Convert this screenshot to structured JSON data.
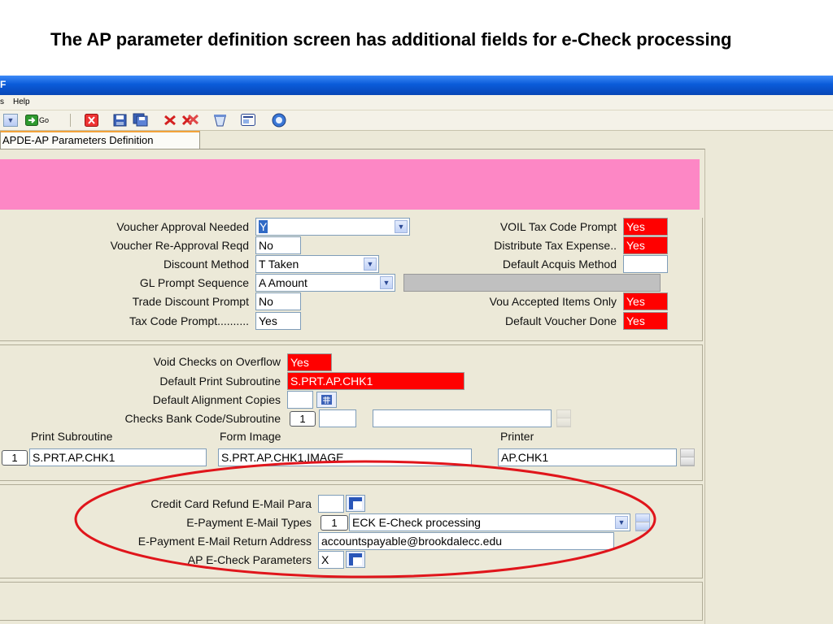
{
  "slide": {
    "title": "The AP parameter definition screen has additional fields for e-Check processing"
  },
  "window": {
    "title_fragment": "F",
    "menu": {
      "item_partial": "s",
      "help": "Help"
    },
    "toolbar": {
      "go_label": "Go"
    },
    "tab_label": "APDE-AP Parameters Definition"
  },
  "section1": {
    "voucher_approval_needed": {
      "label": "Voucher Approval Needed",
      "value": "Y"
    },
    "voucher_reapproval_reqd": {
      "label": "Voucher Re-Approval Reqd",
      "value": "No"
    },
    "discount_method": {
      "label": "Discount Method",
      "value": "T Taken"
    },
    "gl_prompt_sequence": {
      "label": "GL Prompt Sequence",
      "value": "A Amount"
    },
    "trade_discount_prompt": {
      "label": "Trade Discount Prompt",
      "value": "No"
    },
    "tax_code_prompt": {
      "label": "Tax Code Prompt..........",
      "value": "Yes"
    },
    "voil_tax_code_prompt": {
      "label": "VOIL Tax Code Prompt",
      "value": "Yes"
    },
    "distribute_tax_expense": {
      "label": "Distribute Tax Expense..",
      "value": "Yes"
    },
    "default_acquis_method": {
      "label": "Default Acquis Method",
      "value": ""
    },
    "vou_accepted_items_only": {
      "label": "Vou Accepted Items Only",
      "value": "Yes"
    },
    "default_voucher_done": {
      "label": "Default Voucher Done",
      "value": "Yes"
    }
  },
  "section2": {
    "void_checks_on_overflow": {
      "label": "Void Checks on Overflow",
      "value": "Yes"
    },
    "default_print_subroutine": {
      "label": "Default Print Subroutine",
      "value": "S.PRT.AP.CHK1"
    },
    "default_alignment_copies": {
      "label": "Default Alignment Copies",
      "value": ""
    },
    "checks_bank_code_subroutine": {
      "label": "Checks Bank Code/Subroutine",
      "index": "1",
      "code": "",
      "subroutine": ""
    },
    "columns": {
      "print_subroutine": "Print Subroutine",
      "form_image": "Form Image",
      "printer": "Printer"
    },
    "row": {
      "index": "1",
      "print_subroutine": "S.PRT.AP.CHK1",
      "form_image": "S.PRT.AP.CHK1.IMAGE",
      "printer": "AP.CHK1"
    }
  },
  "section3": {
    "credit_card_refund_email_para": {
      "label": "Credit Card Refund E-Mail Para",
      "value": ""
    },
    "epayment_email_types": {
      "label": "E-Payment E-Mail Types",
      "index": "1",
      "value": "ECK E-Check processing"
    },
    "epayment_email_return_address": {
      "label": "E-Payment E-Mail Return Address",
      "value": "accountspayable@brookdalecc.edu"
    },
    "ap_echeck_parameters": {
      "label": "AP E-Check Parameters",
      "value": "X"
    }
  },
  "colors": {
    "highlight_band": "#fd87c5",
    "required_field": "#ff0000",
    "annotation_ellipse": "#e0151b",
    "titlebar": "#0a5bd9"
  }
}
